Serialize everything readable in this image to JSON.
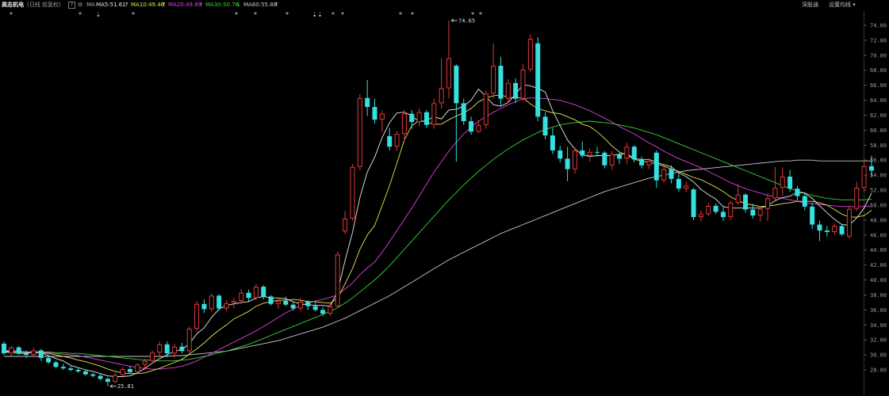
{
  "header": {
    "stock_name": "昊志机电",
    "period": "(日线 前复权)",
    "info_icon": "?",
    "settings_icon": "gear-icon",
    "ma_label": "MA",
    "ma5": "MA5:51.61",
    "ma10": "MA10:49.46",
    "ma20": "MA20:49.89",
    "ma30": "MA30:50.76",
    "ma60": "MA60:55.88",
    "arrow_up": "↑",
    "arrow_down": "↓",
    "exchange_button": "深股通",
    "indicator_settings_button": "设置均线 ▾"
  },
  "colors": {
    "background": "#000000",
    "up_candle": "#e0393a",
    "down_candle": "#35e0e0",
    "ma5": "#e8e8e8",
    "ma10": "#e6e64c",
    "ma20": "#e040e0",
    "ma30": "#3ad23a",
    "ma60": "#c8c8c8",
    "axis_text": "#9a9a9a"
  },
  "chart_data": {
    "type": "candlestick",
    "y_ticks": [
      "74.00",
      "72.00",
      "70.00",
      "68.00",
      "66.00",
      "64.00",
      "62.00",
      "60.00",
      "58.00",
      "56.00",
      "54.00",
      "52.00",
      "50.00",
      "48.00",
      "46.00",
      "44.00",
      "42.00",
      "40.00",
      "38.00",
      "36.00",
      "34.00",
      "32.00",
      "30.00",
      "28.00"
    ],
    "ylim": [
      27,
      75.5
    ],
    "annotations": [
      {
        "text": "74.65",
        "index": 60,
        "price": 74.65
      },
      {
        "text": "25.81",
        "index": 14,
        "price": 25.81
      }
    ],
    "markers": [
      "*",
      "*",
      "⇣",
      "*",
      "*",
      "*",
      "*",
      "⇣⇣",
      "*",
      "*",
      "*",
      "*",
      "*",
      "*"
    ],
    "candles": [
      [
        31.5,
        31.8,
        30.0,
        30.2
      ],
      [
        30.2,
        31.2,
        29.8,
        31.0
      ],
      [
        31.0,
        31.2,
        30.0,
        30.2
      ],
      [
        30.2,
        30.6,
        29.6,
        30.0
      ],
      [
        30.0,
        31.0,
        29.8,
        30.6
      ],
      [
        30.6,
        30.8,
        29.2,
        29.6
      ],
      [
        29.6,
        29.8,
        28.8,
        29.0
      ],
      [
        29.0,
        29.2,
        28.2,
        28.4
      ],
      [
        28.4,
        28.8,
        28.0,
        28.2
      ],
      [
        28.2,
        28.5,
        27.8,
        28.0
      ],
      [
        28.0,
        28.2,
        27.6,
        27.8
      ],
      [
        27.8,
        28.0,
        27.2,
        27.4
      ],
      [
        27.4,
        27.6,
        27.0,
        27.2
      ],
      [
        27.2,
        27.4,
        26.6,
        26.8
      ],
      [
        26.8,
        27.0,
        25.8,
        26.4
      ],
      [
        26.4,
        27.6,
        26.2,
        27.3
      ],
      [
        27.3,
        28.4,
        27.1,
        28.1
      ],
      [
        28.1,
        28.5,
        27.5,
        27.7
      ],
      [
        27.7,
        28.9,
        27.5,
        28.7
      ],
      [
        28.7,
        29.5,
        28.0,
        29.2
      ],
      [
        29.2,
        30.6,
        28.8,
        30.3
      ],
      [
        30.3,
        31.8,
        29.8,
        31.4
      ],
      [
        31.4,
        31.8,
        29.8,
        30.2
      ],
      [
        30.2,
        31.5,
        29.6,
        31.1
      ],
      [
        31.1,
        31.6,
        30.2,
        30.5
      ],
      [
        30.5,
        33.8,
        30.2,
        33.5
      ],
      [
        33.5,
        37.2,
        33.1,
        36.8
      ],
      [
        36.8,
        37.4,
        35.6,
        36.1
      ],
      [
        36.1,
        38.2,
        35.8,
        37.9
      ],
      [
        37.9,
        38.1,
        35.9,
        36.2
      ],
      [
        36.2,
        37.3,
        35.8,
        36.9
      ],
      [
        36.9,
        37.6,
        36.2,
        37.2
      ],
      [
        37.2,
        38.8,
        36.8,
        38.3
      ],
      [
        38.3,
        38.7,
        37.1,
        37.6
      ],
      [
        37.6,
        39.5,
        37.3,
        39.1
      ],
      [
        39.1,
        39.3,
        37.4,
        37.8
      ],
      [
        37.8,
        38.0,
        36.6,
        36.8
      ],
      [
        36.8,
        37.5,
        36.2,
        37.2
      ],
      [
        37.2,
        37.8,
        36.5,
        36.7
      ],
      [
        36.7,
        37.0,
        35.9,
        36.2
      ],
      [
        36.2,
        37.6,
        35.8,
        37.1
      ],
      [
        37.1,
        37.3,
        36.0,
        36.5
      ],
      [
        36.5,
        37.0,
        35.8,
        36.0
      ],
      [
        36.0,
        36.4,
        35.2,
        35.5
      ],
      [
        35.5,
        36.8,
        35.2,
        36.5
      ],
      [
        36.5,
        43.8,
        36.3,
        43.4
      ],
      [
        46.5,
        49.2,
        46.1,
        48.2
      ],
      [
        48.2,
        55.5,
        47.9,
        55.1
      ],
      [
        55.1,
        64.8,
        54.7,
        64.3
      ],
      [
        64.3,
        66.7,
        61.9,
        63.1
      ],
      [
        63.1,
        64.2,
        60.9,
        61.4
      ],
      [
        61.4,
        62.6,
        59.8,
        62.2
      ],
      [
        59.2,
        60.3,
        57.3,
        57.8
      ],
      [
        57.8,
        59.9,
        57.2,
        59.5
      ],
      [
        59.5,
        62.7,
        58.6,
        62.2
      ],
      [
        62.2,
        62.7,
        60.2,
        61.1
      ],
      [
        61.1,
        62.9,
        60.5,
        62.4
      ],
      [
        62.4,
        62.7,
        60.3,
        60.7
      ],
      [
        60.7,
        64.2,
        60.2,
        63.6
      ],
      [
        63.6,
        69.6,
        62.9,
        65.6
      ],
      [
        65.6,
        74.65,
        64.3,
        69.6
      ],
      [
        68.6,
        68.8,
        55.8,
        63.6
      ],
      [
        63.6,
        64.2,
        60.7,
        61.2
      ],
      [
        61.2,
        61.8,
        59.4,
        59.8
      ],
      [
        59.8,
        61.3,
        59.6,
        60.7
      ],
      [
        60.7,
        65.3,
        60.2,
        64.9
      ],
      [
        64.9,
        71.6,
        64.2,
        68.6
      ],
      [
        68.6,
        69.8,
        63.2,
        64.2
      ],
      [
        64.2,
        66.8,
        63.8,
        66.3
      ],
      [
        66.3,
        66.9,
        63.6,
        64.2
      ],
      [
        64.2,
        68.8,
        63.9,
        68.1
      ],
      [
        68.1,
        72.8,
        67.8,
        72.2
      ],
      [
        71.6,
        72.4,
        61.2,
        61.8
      ],
      [
        61.8,
        62.4,
        58.8,
        59.3
      ],
      [
        59.3,
        60.3,
        56.8,
        57.3
      ],
      [
        57.3,
        57.9,
        55.7,
        56.2
      ],
      [
        56.2,
        57.8,
        53.2,
        54.8
      ],
      [
        54.8,
        57.7,
        54.2,
        57.3
      ],
      [
        57.3,
        58.5,
        56.3,
        56.6
      ],
      [
        56.6,
        57.6,
        55.8,
        57.1
      ],
      [
        57.1,
        57.8,
        56.5,
        57.0
      ],
      [
        57.0,
        57.2,
        54.9,
        55.3
      ],
      [
        55.3,
        57.2,
        54.7,
        56.8
      ],
      [
        56.8,
        57.0,
        55.5,
        56.2
      ],
      [
        56.2,
        58.3,
        55.5,
        57.8
      ],
      [
        57.8,
        58.0,
        55.7,
        56.1
      ],
      [
        56.1,
        56.5,
        54.9,
        55.3
      ],
      [
        55.3,
        56.2,
        54.8,
        55.9
      ],
      [
        57.0,
        57.3,
        52.3,
        53.3
      ],
      [
        53.3,
        55.1,
        53.0,
        54.8
      ],
      [
        54.8,
        55.3,
        52.9,
        53.5
      ],
      [
        53.5,
        54.2,
        51.8,
        52.2
      ],
      [
        52.2,
        53.1,
        51.7,
        52.6
      ],
      [
        52.1,
        52.3,
        48.0,
        48.4
      ],
      [
        48.4,
        49.3,
        47.8,
        48.8
      ],
      [
        48.8,
        50.3,
        48.5,
        49.9
      ],
      [
        49.9,
        50.2,
        48.8,
        49.1
      ],
      [
        49.1,
        49.8,
        47.9,
        48.4
      ],
      [
        48.4,
        50.6,
        48.0,
        50.3
      ],
      [
        50.3,
        52.8,
        50.0,
        51.4
      ],
      [
        51.4,
        51.6,
        49.0,
        49.4
      ],
      [
        49.4,
        50.2,
        48.2,
        48.6
      ],
      [
        48.6,
        49.8,
        47.8,
        49.5
      ],
      [
        49.5,
        51.6,
        47.9,
        50.9
      ],
      [
        50.9,
        55.1,
        50.6,
        52.3
      ],
      [
        52.3,
        55.0,
        51.2,
        53.8
      ],
      [
        53.8,
        54.7,
        51.8,
        52.2
      ],
      [
        52.2,
        52.6,
        50.6,
        51.2
      ],
      [
        51.2,
        51.7,
        49.3,
        49.8
      ],
      [
        49.8,
        50.3,
        46.8,
        47.4
      ],
      [
        47.4,
        47.9,
        45.2,
        46.6
      ],
      [
        46.6,
        47.2,
        45.8,
        46.4
      ],
      [
        46.4,
        47.6,
        46.0,
        47.2
      ],
      [
        47.2,
        47.4,
        45.9,
        46.1
      ],
      [
        45.8,
        49.9,
        45.5,
        49.5
      ],
      [
        49.5,
        53.1,
        49.2,
        52.3
      ],
      [
        52.3,
        55.9,
        51.8,
        55.2
      ],
      [
        55.2,
        56.6,
        53.8,
        54.6
      ]
    ],
    "ma5": [
      30.4,
      30.3,
      30.2,
      30.2,
      30.4,
      30.3,
      29.9,
      29.5,
      29.2,
      28.6,
      28.3,
      28.0,
      27.8,
      27.5,
      27.2,
      27.1,
      27.1,
      27.2,
      27.6,
      28.2,
      28.9,
      29.5,
      30.0,
      30.5,
      30.7,
      31.5,
      32.8,
      33.6,
      35.0,
      36.1,
      36.6,
      36.8,
      37.0,
      37.1,
      37.6,
      37.8,
      37.6,
      37.6,
      37.5,
      37.1,
      36.8,
      36.7,
      36.6,
      36.6,
      36.5,
      38.5,
      42.6,
      46.3,
      51.0,
      54.4,
      56.4,
      59.0,
      61.0,
      62.3,
      62.4,
      61.9,
      61.1,
      61.3,
      61.8,
      61.5,
      62.7,
      62.8,
      63.2,
      64.0,
      65.5,
      64.5,
      63.4,
      63.2,
      63.7,
      64.8,
      66.1,
      65.9,
      65.6,
      65.1,
      62.6,
      60.6,
      58.7,
      57.5,
      56.7,
      56.5,
      56.6,
      56.6,
      56.6,
      56.8,
      56.9,
      56.2,
      56.1,
      56.1,
      55.7,
      55.4,
      55.1,
      54.3,
      53.8,
      53.1,
      52.1,
      51.4,
      50.8,
      49.8,
      49.6,
      49.6,
      49.6,
      49.6,
      49.6,
      49.9,
      50.6,
      51.0,
      51.2,
      51.7,
      51.6,
      50.9,
      49.9,
      49.0,
      48.1,
      47.4,
      47.3,
      48.3,
      49.6,
      51.6
    ],
    "ma10": [
      30.5,
      30.5,
      30.4,
      30.3,
      30.3,
      30.3,
      30.2,
      30.0,
      29.8,
      29.6,
      29.3,
      29.1,
      28.8,
      28.5,
      28.1,
      27.8,
      27.6,
      27.5,
      27.5,
      27.6,
      27.9,
      28.2,
      28.6,
      29.0,
      29.4,
      30.1,
      30.8,
      31.6,
      32.5,
      33.3,
      34.0,
      34.8,
      35.3,
      35.8,
      36.5,
      36.9,
      37.1,
      37.3,
      37.3,
      37.4,
      37.3,
      37.1,
      37.1,
      37.0,
      36.9,
      37.6,
      39.5,
      41.5,
      44.1,
      46.0,
      47.3,
      49.9,
      52.6,
      55.6,
      58.7,
      60.6,
      61.3,
      61.1,
      60.8,
      60.8,
      61.4,
      61.9,
      62.3,
      62.9,
      63.8,
      64.3,
      64.6,
      64.7,
      64.4,
      64.3,
      64.3,
      63.5,
      62.9,
      62.6,
      62.3,
      62.2,
      61.8,
      61.4,
      60.8,
      60.5,
      59.8,
      58.9,
      57.9,
      57.1,
      56.7,
      56.1,
      55.9,
      55.7,
      55.5,
      55.2,
      54.8,
      54.5,
      54.1,
      53.7,
      53.4,
      52.9,
      52.4,
      51.8,
      51.1,
      50.6,
      50.2,
      50.0,
      49.8,
      49.9,
      50.0,
      50.2,
      50.3,
      50.5,
      50.5,
      50.5,
      50.3,
      50.0,
      49.4,
      48.8,
      48.4,
      48.4,
      48.6,
      49.3
    ],
    "ma20": [
      30.6,
      30.6,
      30.5,
      30.4,
      30.4,
      30.4,
      30.3,
      30.2,
      30.1,
      30.0,
      29.9,
      29.7,
      29.5,
      29.3,
      29.1,
      28.9,
      28.7,
      28.5,
      28.3,
      28.2,
      28.1,
      28.1,
      28.2,
      28.3,
      28.5,
      28.8,
      29.2,
      29.7,
      30.2,
      30.7,
      31.2,
      31.7,
      32.2,
      32.7,
      33.2,
      33.8,
      34.4,
      35.0,
      35.6,
      36.1,
      36.6,
      36.9,
      37.2,
      37.4,
      37.7,
      38.0,
      38.8,
      39.6,
      40.7,
      41.6,
      42.4,
      43.7,
      45.1,
      46.6,
      48.1,
      49.6,
      51.2,
      52.8,
      54.4,
      55.8,
      57.2,
      58.4,
      59.5,
      60.4,
      61.2,
      61.8,
      62.4,
      62.9,
      63.4,
      63.8,
      64.2,
      64.3,
      64.3,
      64.2,
      64.1,
      64.0,
      63.7,
      63.4,
      63.0,
      62.6,
      62.1,
      61.6,
      61.1,
      60.5,
      60.0,
      59.5,
      58.9,
      58.3,
      57.8,
      57.2,
      56.7,
      56.2,
      55.8,
      55.4,
      55.0,
      54.5,
      54.0,
      53.5,
      53.0,
      52.6,
      52.2,
      51.9,
      51.6,
      51.3,
      51.1,
      50.9,
      50.7,
      50.5,
      50.3,
      50.2,
      50.1,
      50.0,
      49.9,
      49.8,
      49.8,
      49.8,
      49.8,
      49.9
    ],
    "ma30": [
      30.4,
      30.4,
      30.4,
      30.4,
      30.4,
      30.4,
      30.4,
      30.3,
      30.3,
      30.2,
      30.2,
      30.1,
      30.0,
      29.9,
      29.8,
      29.7,
      29.6,
      29.5,
      29.4,
      29.3,
      29.3,
      29.2,
      29.2,
      29.2,
      29.3,
      29.4,
      29.6,
      29.8,
      30.0,
      30.3,
      30.5,
      30.8,
      31.1,
      31.4,
      31.8,
      32.2,
      32.6,
      33.0,
      33.4,
      33.8,
      34.2,
      34.6,
      35.0,
      35.4,
      35.8,
      36.3,
      36.9,
      37.6,
      38.4,
      39.2,
      40.0,
      40.9,
      41.9,
      43.0,
      44.1,
      45.2,
      46.3,
      47.4,
      48.5,
      49.6,
      50.7,
      51.7,
      52.7,
      53.6,
      54.5,
      55.3,
      56.1,
      56.8,
      57.5,
      58.1,
      58.7,
      59.2,
      59.7,
      60.1,
      60.4,
      60.7,
      60.9,
      61.0,
      61.1,
      61.2,
      61.1,
      61.0,
      60.9,
      60.7,
      60.5,
      60.3,
      60.0,
      59.7,
      59.4,
      59.0,
      58.6,
      58.2,
      57.8,
      57.4,
      57.0,
      56.6,
      56.2,
      55.8,
      55.4,
      55.0,
      54.6,
      54.2,
      53.8,
      53.4,
      53.0,
      52.6,
      52.2,
      51.9,
      51.6,
      51.3,
      51.1,
      50.9,
      50.8,
      50.7,
      50.7,
      50.7,
      50.7,
      50.8
    ],
    "ma60": [
      29.8,
      29.8,
      29.8,
      29.8,
      29.8,
      29.8,
      29.8,
      29.8,
      29.8,
      29.8,
      29.8,
      29.8,
      29.8,
      29.8,
      29.8,
      29.8,
      29.8,
      29.8,
      29.8,
      29.8,
      29.8,
      29.8,
      29.8,
      29.9,
      29.9,
      30.0,
      30.1,
      30.2,
      30.3,
      30.4,
      30.5,
      30.7,
      30.9,
      31.1,
      31.3,
      31.5,
      31.7,
      31.9,
      32.2,
      32.5,
      32.8,
      33.1,
      33.4,
      33.7,
      34.1,
      34.5,
      34.9,
      35.4,
      35.9,
      36.4,
      36.9,
      37.4,
      37.9,
      38.5,
      39.1,
      39.7,
      40.3,
      40.9,
      41.5,
      42.1,
      42.7,
      43.2,
      43.7,
      44.2,
      44.7,
      45.2,
      45.7,
      46.2,
      46.6,
      47.0,
      47.4,
      47.8,
      48.2,
      48.6,
      49.0,
      49.4,
      49.8,
      50.2,
      50.6,
      51.0,
      51.4,
      51.8,
      52.1,
      52.4,
      52.7,
      53.0,
      53.3,
      53.6,
      53.8,
      54.0,
      54.2,
      54.4,
      54.6,
      54.7,
      54.8,
      54.9,
      55.0,
      55.1,
      55.2,
      55.3,
      55.4,
      55.5,
      55.6,
      55.7,
      55.8,
      55.9,
      55.9,
      56.0,
      56.0,
      56.0,
      55.9,
      55.9,
      55.9,
      55.9,
      55.9,
      55.9,
      55.9,
      55.9
    ]
  }
}
